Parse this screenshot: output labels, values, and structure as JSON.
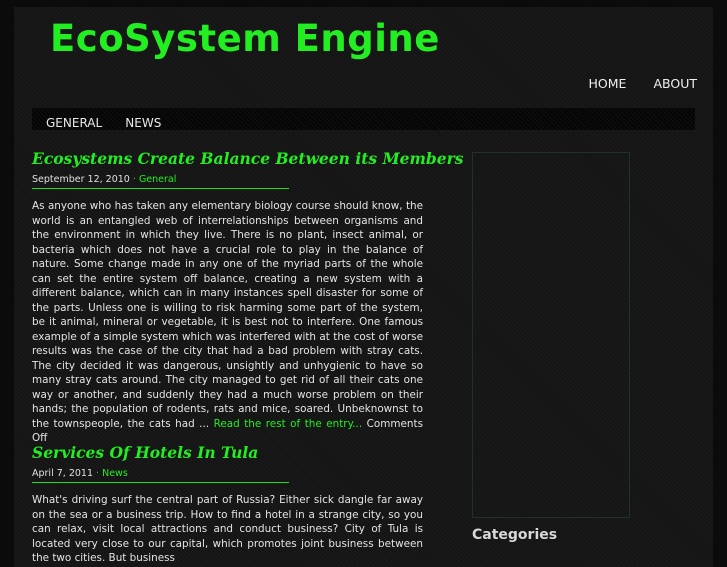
{
  "site": {
    "title": "EcoSystem Engine"
  },
  "top_nav": [
    {
      "label": "HOME"
    },
    {
      "label": "ABOUT"
    }
  ],
  "category_nav": [
    {
      "label": "GENERAL"
    },
    {
      "label": "NEWS"
    }
  ],
  "posts": [
    {
      "title": "Ecosystems Create Balance Between its Members",
      "date": "September 12, 2010",
      "separator": "·",
      "category": "General",
      "excerpt": "As anyone who has taken any elementary biology course should know, the world is an entangled web of interrelationships between organisms and the environment in which they live. There is no plant, insect animal, or bacteria which does not have a crucial role to play in the balance of nature. Some change made in any one of the myriad parts of the whole can set the entire system off balance, creating a new system with a different balance, which can in many instances spell disaster for some of the parts. Unless one is willing to risk harming some part of the system, be it animal, mineral or vegetable, it is best not to interfere. One famous example of a simple system which was interfered with at the cost of worse results was the case of the city that had a bad problem with stray cats. The city decided it was dangerous, unsightly and unhygienic to have so many stray cats around. The city managed to get rid of all their cats one way or another, and suddenly they had a much worse problem on their hands; the population of rodents, rats and mice, soared. Unbeknownst to the townspeople, the cats had ...",
      "read_more": "Read the rest of the entry...",
      "comments": "Comments Off"
    },
    {
      "title": "Services Of Hotels In Tula",
      "date": "April 7, 2011",
      "separator": "·",
      "category": "News",
      "excerpt": "What's driving surf the central part of Russia? Either sick dangle far away on the sea or a business trip. How to find a hotel in a strange city, so you can relax, visit local attractions and conduct business? City of Tula is located very close to our capital, which promotes joint business between the two cities. But business"
    }
  ],
  "sidebar": {
    "categories_heading": "Categories"
  }
}
